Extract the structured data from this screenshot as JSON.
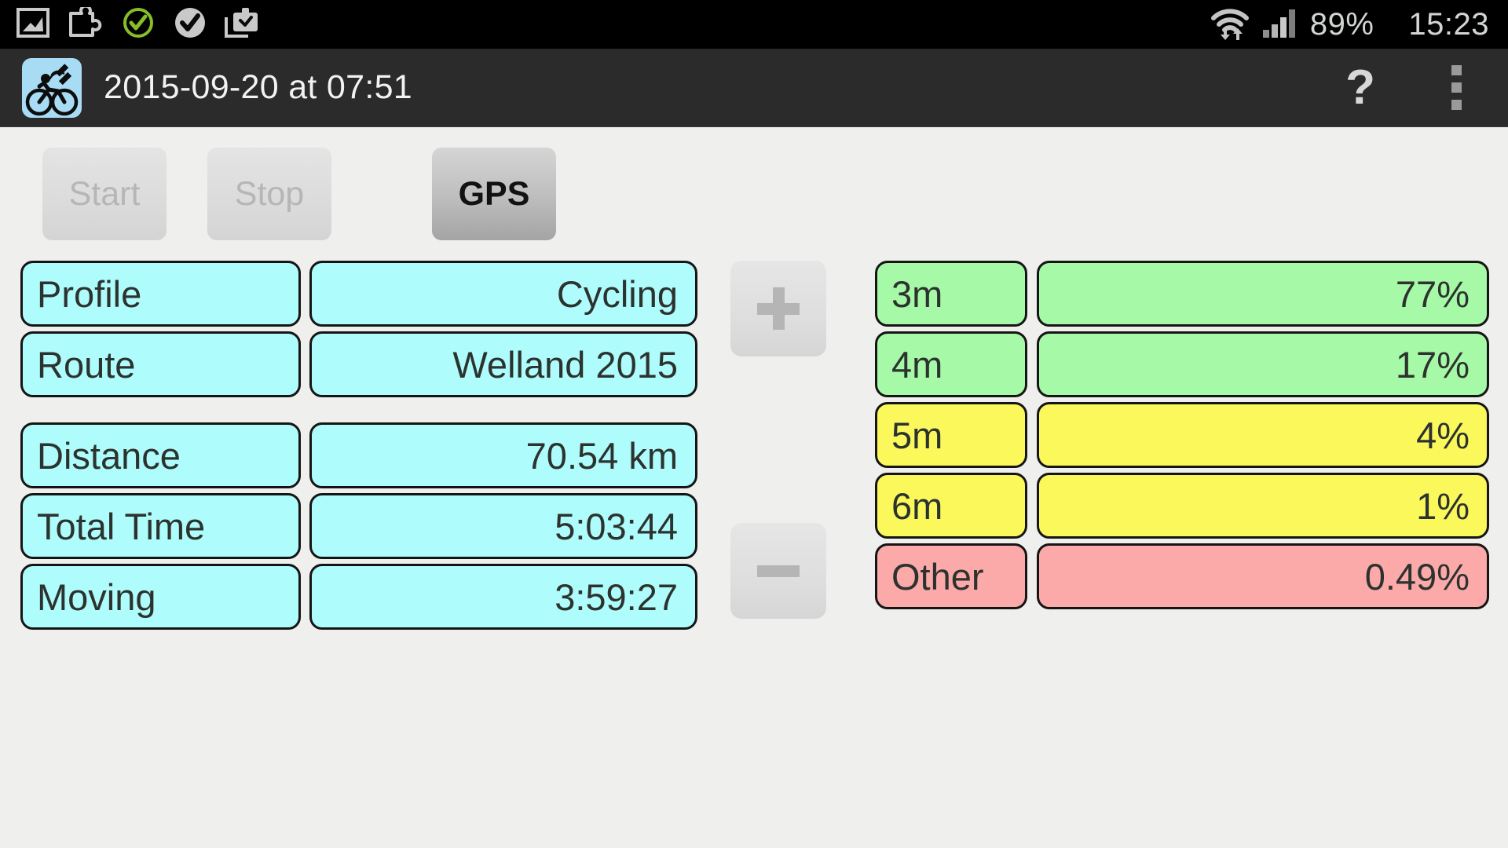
{
  "status_bar": {
    "icons": [
      "gallery-icon",
      "puzzle-plugin-icon",
      "green-check-circle-icon",
      "gray-check-circle-icon",
      "clipboard-download-icon"
    ],
    "wifi_icon": "wifi-transfer-icon",
    "signal_icon": "cellular-signal-icon",
    "battery": "89%",
    "clock": "15:23"
  },
  "title_bar": {
    "app_icon": "cyclist-gps-icon",
    "title": "2015-09-20 at 07:51",
    "help_label": "?",
    "overflow_label": "overflow-menu"
  },
  "controls": {
    "start_label": "Start",
    "stop_label": "Stop",
    "gps_label": "GPS",
    "start_enabled": false,
    "stop_enabled": false,
    "gps_enabled": true
  },
  "stepper": {
    "plus_label": "+",
    "minus_label": "−"
  },
  "summary": {
    "rows": [
      {
        "label": "Profile",
        "value": "Cycling"
      },
      {
        "label": "Route",
        "value": "Welland 2015"
      },
      {
        "label": "Distance",
        "value": "70.54 km"
      },
      {
        "label": "Total Time",
        "value": "5:03:44"
      },
      {
        "label": "Moving",
        "value": "3:59:27"
      }
    ]
  },
  "accuracy": {
    "rows": [
      {
        "key": "3m",
        "value": "77%",
        "color": "#a6f9a6"
      },
      {
        "key": "4m",
        "value": "17%",
        "color": "#a6f9a6"
      },
      {
        "key": "5m",
        "value": "4%",
        "color": "#fbf85c"
      },
      {
        "key": "6m",
        "value": "1%",
        "color": "#fbf85c"
      },
      {
        "key": "Other",
        "value": "0.49%",
        "color": "#fba9a9"
      }
    ]
  },
  "theme": {
    "field_bg": "#aefcfb",
    "green": "#a6f9a6",
    "yellow": "#fbf85c",
    "pink": "#fba9a9",
    "page_bg": "#efefee",
    "title_bar_bg": "#2b2b2b",
    "status_bar_bg": "#000000"
  }
}
